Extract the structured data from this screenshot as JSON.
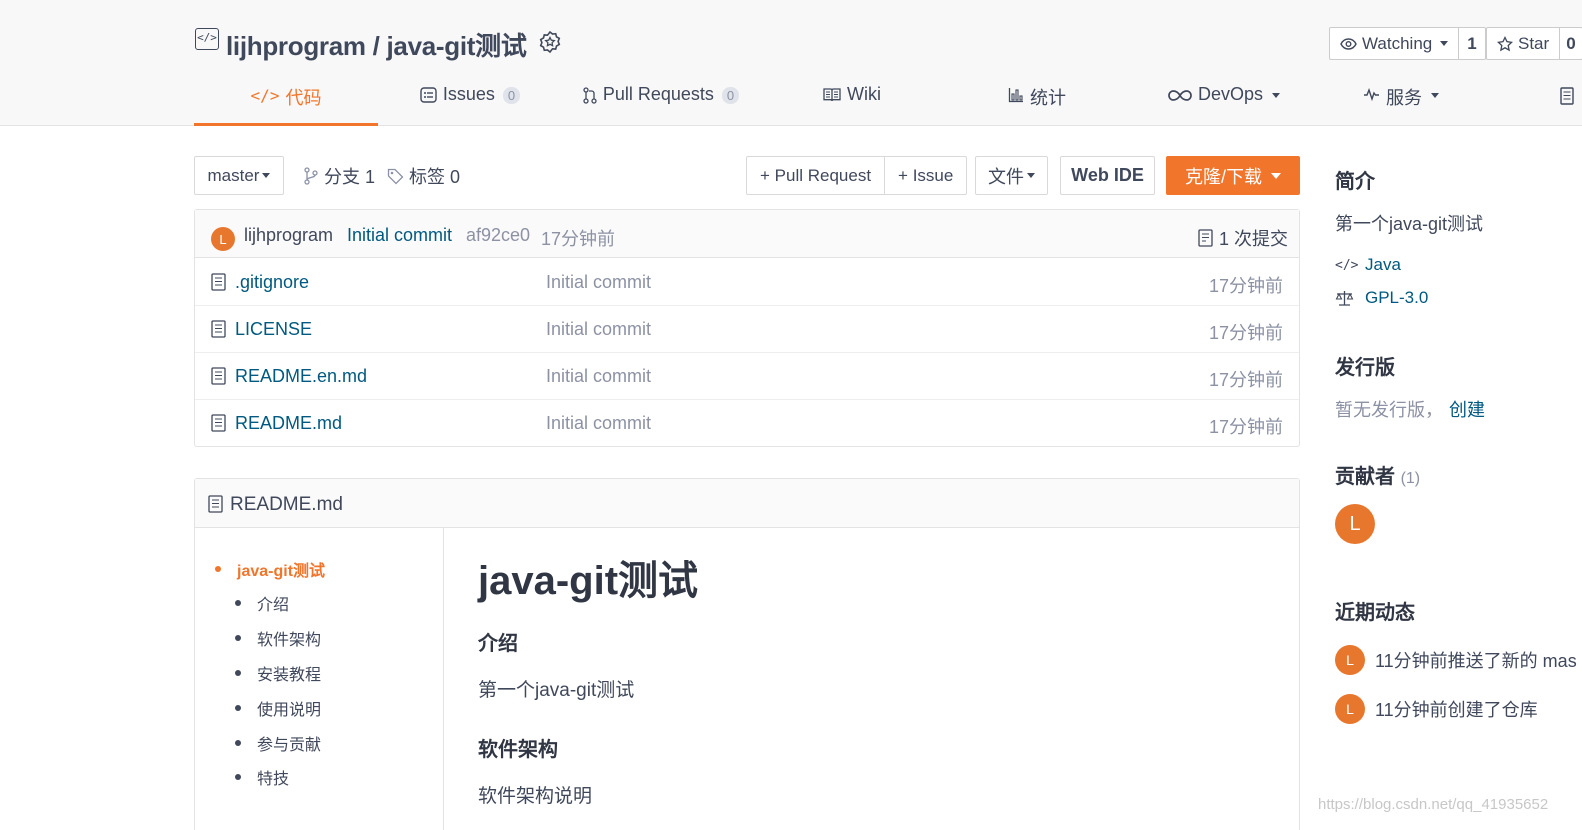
{
  "repo": {
    "owner": "lijhprogram",
    "separator": " / ",
    "name": "java-git测试"
  },
  "watch": {
    "label": "Watching",
    "count": "1"
  },
  "star": {
    "label": "Star",
    "count": "0"
  },
  "nav": {
    "code": "代码",
    "issues": "Issues",
    "issues_count": "0",
    "pulls": "Pull Requests",
    "pulls_count": "0",
    "wiki": "Wiki",
    "stats": "统计",
    "devops": "DevOps",
    "service": "服务"
  },
  "toolbar": {
    "branch": "master",
    "branches": "分支 1",
    "tags": "标签 0",
    "pull_request": "+ Pull Request",
    "issue": "+ Issue",
    "file": "文件",
    "web_ide": "Web IDE",
    "clone": "克隆/下载"
  },
  "commit": {
    "avatar": "L",
    "author": "lijhprogram",
    "message": "Initial commit",
    "hash": "af92ce0",
    "time": "17分钟前",
    "count_label": "1 次提交"
  },
  "files": [
    {
      "name": ".gitignore",
      "message": "Initial commit",
      "time": "17分钟前"
    },
    {
      "name": "LICENSE",
      "message": "Initial commit",
      "time": "17分钟前"
    },
    {
      "name": "README.en.md",
      "message": "Initial commit",
      "time": "17分钟前"
    },
    {
      "name": "README.md",
      "message": "Initial commit",
      "time": "17分钟前"
    }
  ],
  "readme": {
    "filename": "README.md",
    "toc": [
      "java-git测试",
      "介绍",
      "软件架构",
      "安装教程",
      "使用说明",
      "参与贡献",
      "特技"
    ],
    "h1": "java-git测试",
    "intro_h": "介绍",
    "intro_p": "第一个java-git测试",
    "arch_h": "软件架构",
    "arch_p": "软件架构说明"
  },
  "sidebar": {
    "about_h": "简介",
    "about_p": "第一个java-git测试",
    "language": "Java",
    "license": "GPL-3.0",
    "releases_h": "发行版",
    "releases_p": "暂无发行版，",
    "releases_create": "创建",
    "contributors_h": "贡献者",
    "contributors_count": "(1)",
    "contributor_avatar": "L",
    "activity_h": "近期动态",
    "activity": [
      {
        "avatar": "L",
        "text": "11分钟前推送了新的 mas"
      },
      {
        "avatar": "L",
        "text": "11分钟前创建了仓库"
      }
    ]
  },
  "watermark": "https://blog.csdn.net/qq_41935652",
  "colors": {
    "accent": "#f1762c",
    "link": "#005980",
    "avatar": "#e8772e"
  }
}
